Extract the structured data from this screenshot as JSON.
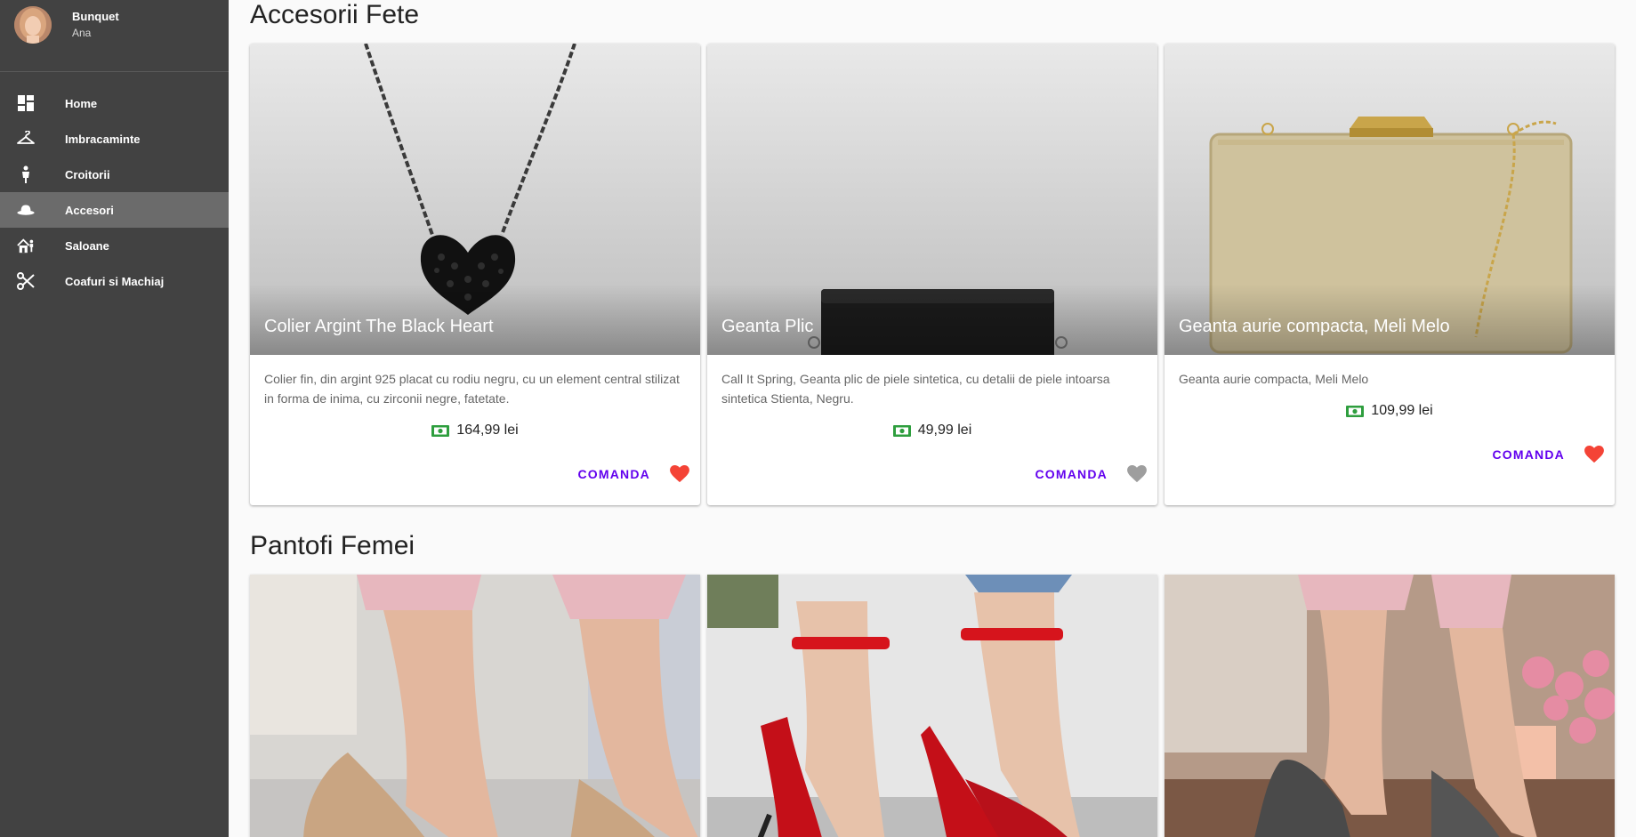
{
  "profile": {
    "name": "Bunquet",
    "subtitle": "Ana"
  },
  "nav": {
    "items": [
      {
        "label": "Home",
        "icon": "dashboard-icon"
      },
      {
        "label": "Imbracaminte",
        "icon": "hanger-icon"
      },
      {
        "label": "Croitorii",
        "icon": "tailor-icon"
      },
      {
        "label": "Accesori",
        "icon": "hat-icon",
        "active": true
      },
      {
        "label": "Saloane",
        "icon": "salon-icon"
      },
      {
        "label": "Coafuri si Machiaj",
        "icon": "scissors-icon"
      }
    ]
  },
  "sections": [
    {
      "title": "Accesorii Fete",
      "cards": [
        {
          "title": "Colier Argint The Black Heart",
          "description": "Colier fin, din argint 925 placat cu rodiu negru, cu un element central stilizat in forma de inima, cu zirconii negre, fatetate.",
          "price": "164,99 lei",
          "action": "COMANDA",
          "favorite": true,
          "image": "necklace"
        },
        {
          "title": "Geanta Plic",
          "description": "Call It Spring, Geanta plic de piele sintetica, cu detalii de piele intoarsa sintetica Stienta, Negru.",
          "price": "49,99 lei",
          "action": "COMANDA",
          "favorite": false,
          "image": "black-clutch"
        },
        {
          "title": "Geanta aurie compacta, Meli Melo",
          "description": "Geanta aurie compacta, Meli Melo",
          "price": "109,99 lei",
          "action": "COMANDA",
          "favorite": true,
          "image": "gold-clutch"
        }
      ]
    },
    {
      "title": "Pantofi Femei",
      "cards": [
        {
          "image": "nude-heels"
        },
        {
          "image": "red-sandals"
        },
        {
          "image": "glitter-heels"
        }
      ]
    }
  ],
  "colors": {
    "sidebar": "#424242",
    "sidebar_active": "#6b6b6b",
    "accent": "#6200ee",
    "heart_on": "#f44336",
    "heart_off": "#9e9e9e",
    "money": "#2e9e3e"
  }
}
